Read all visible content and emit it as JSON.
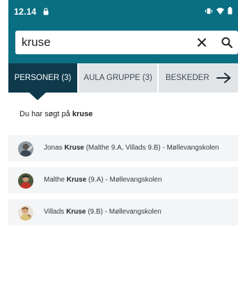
{
  "status_bar": {
    "time": "12.14"
  },
  "search": {
    "query": "kruse",
    "placeholder": ""
  },
  "tabs": [
    {
      "label": "PERSONER (3)"
    },
    {
      "label": "AULA GRUPPE (3)"
    },
    {
      "label": "BESKEDER ("
    }
  ],
  "summary": {
    "prefix": "Du har søgt på ",
    "term": "kruse"
  },
  "results": [
    {
      "first": "Jonas ",
      "highlight": "Kruse",
      "detail": " (Malthe 9.A, Villads 9.B) - Møllevangskolen"
    },
    {
      "first": "Malthe ",
      "highlight": "Kruse",
      "detail": " (9.A) - Møllevangskolen"
    },
    {
      "first": "Villads ",
      "highlight": "Kruse",
      "detail": " (9.B) - Møllevangskolen"
    }
  ],
  "colors": {
    "header": "#0a6f82",
    "active_tab": "#0e3a4c",
    "tab_bg": "#e1e4e7",
    "row_bg": "#f4f5f6"
  }
}
